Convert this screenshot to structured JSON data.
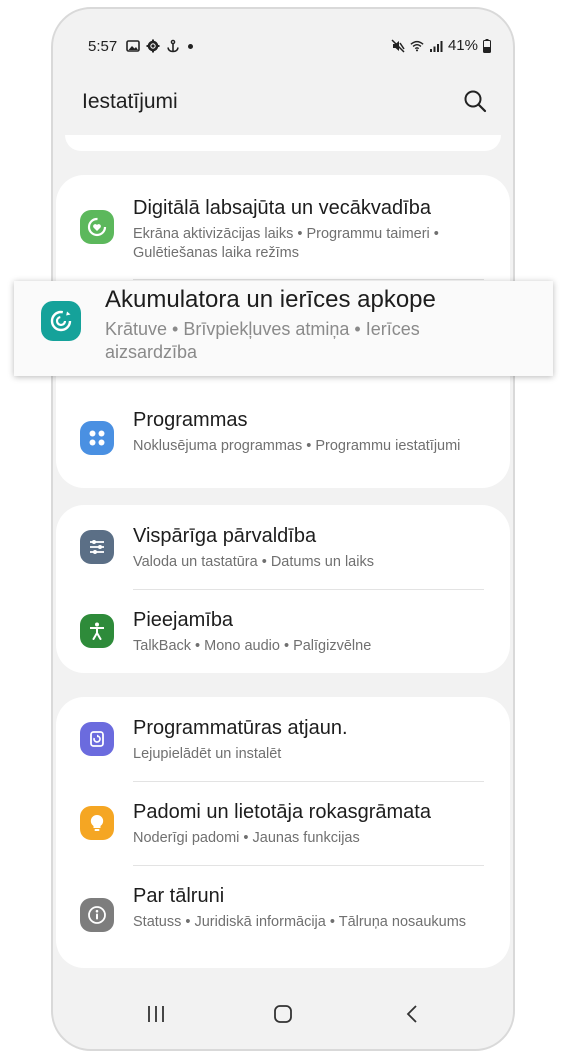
{
  "status_bar": {
    "time": "5:57",
    "left_icons": [
      "image-icon",
      "gear-icon",
      "anchor-icon",
      "dot-icon"
    ],
    "right_icons": [
      "mute-icon",
      "wifi-icon",
      "signal-icon"
    ],
    "battery": "41%"
  },
  "header": {
    "title": "Iestatījumi",
    "search_icon": "search-icon"
  },
  "rows": {
    "digital": {
      "title": "Digitālā labsajūta un vecākvadība",
      "sub": "Ekrāna aktivizācijas laiks  •  Programmu taimeri  •  Gulētiešanas laika režīms",
      "icon": "wellbeing-icon",
      "color": "#5cb85c"
    },
    "battery": {
      "title": "Akumulatora un ierīces apkope",
      "sub": "Krātuve  •  Brīvpiekļuves atmiņa  •  Ierīces aizsardzība",
      "icon": "device-care-icon",
      "color": "#15a29a"
    },
    "apps": {
      "title": "Programmas",
      "sub": "Noklusējuma programmas  •  Programmu iestatījumi",
      "icon": "apps-icon",
      "color": "#4a90e2"
    },
    "general": {
      "title": "Vispārīga pārvaldība",
      "sub": "Valoda un tastatūra  •  Datums un laiks",
      "icon": "sliders-icon",
      "color": "#5b6f86"
    },
    "accessibility": {
      "title": "Pieejamība",
      "sub": "TalkBack  •  Mono audio  •  Palīgizvēlne",
      "icon": "accessibility-icon",
      "color": "#2e8b3a"
    },
    "update": {
      "title": "Programmatūras atjaun.",
      "sub": "Lejupielādēt un instalēt",
      "icon": "software-update-icon",
      "color": "#6b6bde"
    },
    "tips": {
      "title": "Padomi un lietotāja rokasgrāmata",
      "sub": "Noderīgi padomi  •  Jaunas funkcijas",
      "icon": "lightbulb-icon",
      "color": "#f5a623"
    },
    "about": {
      "title": "Par tālruni",
      "sub": "Statuss  •  Juridiskā informācija  •  Tālruņa nosaukums",
      "icon": "info-icon",
      "color": "#7d7d7d"
    }
  },
  "navbar": {
    "recents_icon": "recents-icon",
    "home_icon": "home-icon",
    "back_icon": "back-icon"
  }
}
